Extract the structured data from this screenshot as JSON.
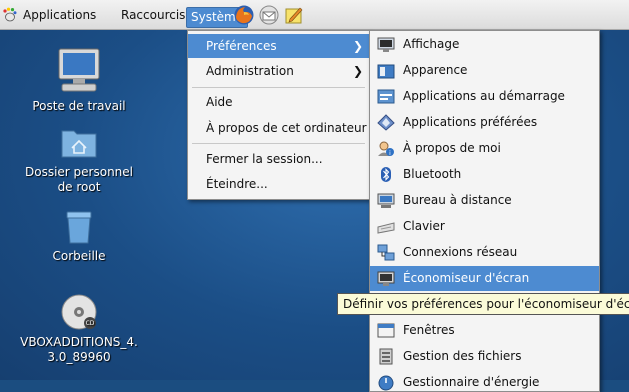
{
  "panel": {
    "applications": "Applications",
    "raccourcis": "Raccourcis",
    "systeme": "Système",
    "launchers": [
      "firefox-icon",
      "mail-icon",
      "notes-icon"
    ]
  },
  "desktop": {
    "icons": [
      {
        "label": "Poste de travail",
        "icon": "computer-icon"
      },
      {
        "label": "Dossier personnel\nde root",
        "icon": "home-folder-icon"
      },
      {
        "label": "Corbeille",
        "icon": "trash-icon"
      },
      {
        "label": "VBOXADDITIONS_4.\n3.0_89960",
        "icon": "cd-icon"
      }
    ]
  },
  "system_menu": {
    "items": [
      "Préférences",
      "Administration",
      "Aide",
      "À propos de cet ordinateur",
      "Fermer la session...",
      "Éteindre..."
    ],
    "submenu_arrow": "❯"
  },
  "preferences_menu": {
    "items": [
      {
        "label": "Affichage",
        "icon": "display-icon"
      },
      {
        "label": "Apparence",
        "icon": "appearance-icon"
      },
      {
        "label": "Applications au démarrage",
        "icon": "startup-apps-icon"
      },
      {
        "label": "Applications préférées",
        "icon": "preferred-apps-icon"
      },
      {
        "label": "À propos de moi",
        "icon": "about-me-icon"
      },
      {
        "label": "Bluetooth",
        "icon": "bluetooth-icon"
      },
      {
        "label": "Bureau à distance",
        "icon": "remote-desktop-icon"
      },
      {
        "label": "Clavier",
        "icon": "keyboard-icon"
      },
      {
        "label": "Connexions réseau",
        "icon": "network-icon"
      },
      {
        "label": "Économiseur d'écran",
        "icon": "screensaver-icon"
      },
      {
        "label": "Fenêtres",
        "icon": "windows-icon"
      },
      {
        "label": "Gestion des fichiers",
        "icon": "file-management-icon"
      },
      {
        "label": "Gestionnaire d'énergie",
        "icon": "power-manager-icon"
      }
    ],
    "highlighted": "Économiseur d'écran"
  },
  "tooltip": {
    "text": "Définir vos préférences pour l'économiseur d'écran"
  },
  "colors": {
    "highlight": "#4d8bd1",
    "desktop": "#1b4e86",
    "menu_bg": "#f4f4f4"
  }
}
